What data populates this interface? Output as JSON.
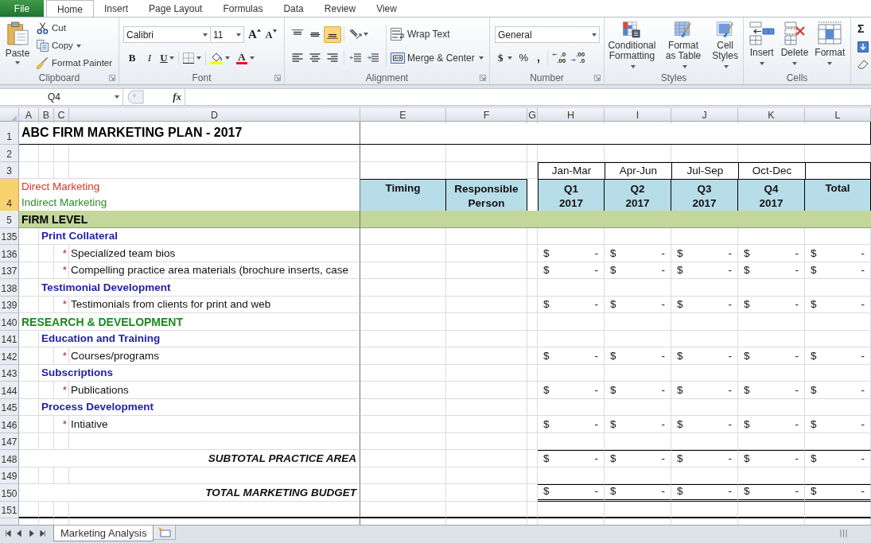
{
  "ribbon": {
    "file_tab": "File",
    "tabs": [
      {
        "label": "Home",
        "selected": true
      },
      {
        "label": "Insert",
        "selected": false
      },
      {
        "label": "Page Layout",
        "selected": false
      },
      {
        "label": "Formulas",
        "selected": false
      },
      {
        "label": "Data",
        "selected": false
      },
      {
        "label": "Review",
        "selected": false
      },
      {
        "label": "View",
        "selected": false
      }
    ]
  },
  "clipboard": {
    "paste": "Paste",
    "cut": "Cut",
    "copy": "Copy",
    "format_painter": "Format Painter",
    "label": "Clipboard"
  },
  "font": {
    "name": "Calibri",
    "size": "11",
    "grow": "A",
    "shrink": "A",
    "styles": [
      {
        "kind": "bold",
        "label": "B"
      },
      {
        "kind": "italic",
        "label": "I"
      },
      {
        "kind": "underline",
        "label": "U"
      }
    ],
    "font_color": "A",
    "label": "Font"
  },
  "alignment": {
    "vertical": [
      {
        "kind": "top",
        "selected": false
      },
      {
        "kind": "middle",
        "selected": false
      },
      {
        "kind": "bottom",
        "selected": true
      }
    ],
    "horizontal": [
      {
        "kind": "left",
        "selected": false
      },
      {
        "kind": "center",
        "selected": false
      },
      {
        "kind": "right",
        "selected": false
      }
    ],
    "wrap_text": "Wrap Text",
    "merge_center": "Merge & Center",
    "label": "Alignment"
  },
  "number": {
    "format": "General",
    "currency": "$",
    "percent": "%",
    "comma": ",",
    "increase_decimal": [
      ".0",
      ".00"
    ],
    "decrease_decimal": [
      ".00",
      ".0"
    ],
    "label": "Number"
  },
  "styles": {
    "buttons": [
      "Conditional\nFormatting",
      "Format\nas Table",
      "Cell\nStyles"
    ],
    "label": "Styles"
  },
  "cells": {
    "buttons": [
      "Insert",
      "Delete",
      "Format"
    ],
    "label": "Cells"
  },
  "editing": {
    "autosum": "Σ"
  },
  "formula_bar": {
    "name_box": "Q4",
    "function_label": "fx"
  },
  "grid": {
    "columns": [
      "A",
      "B",
      "C",
      "D",
      "E",
      "F",
      "G",
      "H",
      "I",
      "J",
      "K",
      "L"
    ],
    "rows": [
      {
        "number": "1",
        "selected": false,
        "kind": "title",
        "text": "ABC FIRM MARKETING PLAN - 2017"
      },
      {
        "number": "2",
        "selected": false,
        "kind": "blank"
      },
      {
        "number": "3",
        "selected": false,
        "kind": "periods",
        "periods": [
          "Jan-Mar",
          "Apr-Jun",
          "Jul-Sep",
          "Oct-Dec"
        ]
      },
      {
        "number": "4",
        "selected": true,
        "kind": "header",
        "legend": [
          {
            "text": "Direct Marketing",
            "color": "#e0302a"
          },
          {
            "text": "Indirect Marketing",
            "color": "#2f8a2f"
          }
        ],
        "timing": "Timing",
        "person": "Responsible Person",
        "quarters": [
          "Q1\n2017",
          "Q2\n2017",
          "Q3\n2017",
          "Q4\n2017"
        ],
        "total": "Total"
      },
      {
        "number": "5",
        "selected": false,
        "kind": "band",
        "text": "FIRM LEVEL"
      },
      {
        "number": "135",
        "selected": false,
        "kind": "subsection",
        "text": "Print Collateral"
      },
      {
        "number": "136",
        "selected": false,
        "kind": "item",
        "bullet": "*",
        "text": "Specialized team bios",
        "amounts": [
          {
            "symbol": "$",
            "value": "-"
          },
          {
            "symbol": "$",
            "value": "-"
          },
          {
            "symbol": "$",
            "value": "-"
          },
          {
            "symbol": "$",
            "value": "-"
          },
          {
            "symbol": "$",
            "value": "-"
          }
        ]
      },
      {
        "number": "137",
        "selected": false,
        "kind": "item",
        "bullet": "*",
        "text": "Compelling practice area materials (brochure inserts, case",
        "amounts": [
          {
            "symbol": "$",
            "value": "-"
          },
          {
            "symbol": "$",
            "value": "-"
          },
          {
            "symbol": "$",
            "value": "-"
          },
          {
            "symbol": "$",
            "value": "-"
          },
          {
            "symbol": "$",
            "value": "-"
          }
        ]
      },
      {
        "number": "138",
        "selected": false,
        "kind": "subsection",
        "text": "Testimonial Development"
      },
      {
        "number": "139",
        "selected": false,
        "kind": "item",
        "bullet": "*",
        "text": "Testimonials from clients for print and web",
        "amounts": [
          {
            "symbol": "$",
            "value": "-"
          },
          {
            "symbol": "$",
            "value": "-"
          },
          {
            "symbol": "$",
            "value": "-"
          },
          {
            "symbol": "$",
            "value": "-"
          },
          {
            "symbol": "$",
            "value": "-"
          }
        ]
      },
      {
        "number": "140",
        "selected": false,
        "kind": "category",
        "text": "RESEARCH & DEVELOPMENT",
        "color": "#1e8a1e"
      },
      {
        "number": "141",
        "selected": false,
        "kind": "subsection",
        "text": "Education and Training"
      },
      {
        "number": "142",
        "selected": false,
        "kind": "item",
        "bullet": "*",
        "text": "Courses/programs",
        "amounts": [
          {
            "symbol": "$",
            "value": "-"
          },
          {
            "symbol": "$",
            "value": "-"
          },
          {
            "symbol": "$",
            "value": "-"
          },
          {
            "symbol": "$",
            "value": "-"
          },
          {
            "symbol": "$",
            "value": "-"
          }
        ]
      },
      {
        "number": "143",
        "selected": false,
        "kind": "subsection",
        "text": "Subscriptions"
      },
      {
        "number": "144",
        "selected": false,
        "kind": "item",
        "bullet": "*",
        "text": "Publications",
        "amounts": [
          {
            "symbol": "$",
            "value": "-"
          },
          {
            "symbol": "$",
            "value": "-"
          },
          {
            "symbol": "$",
            "value": "-"
          },
          {
            "symbol": "$",
            "value": "-"
          },
          {
            "symbol": "$",
            "value": "-"
          }
        ]
      },
      {
        "number": "145",
        "selected": false,
        "kind": "subsection",
        "text": "Process Development"
      },
      {
        "number": "146",
        "selected": false,
        "kind": "item",
        "bullet": "*",
        "text": "Intiative",
        "amounts": [
          {
            "symbol": "$",
            "value": "-"
          },
          {
            "symbol": "$",
            "value": "-"
          },
          {
            "symbol": "$",
            "value": "-"
          },
          {
            "symbol": "$",
            "value": "-"
          },
          {
            "symbol": "$",
            "value": "-"
          }
        ]
      },
      {
        "number": "147",
        "selected": false,
        "kind": "blank"
      },
      {
        "number": "148",
        "selected": false,
        "kind": "subtotal",
        "text": "SUBTOTAL PRACTICE AREA",
        "amounts": [
          {
            "symbol": "$",
            "value": "-"
          },
          {
            "symbol": "$",
            "value": "-"
          },
          {
            "symbol": "$",
            "value": "-"
          },
          {
            "symbol": "$",
            "value": "-"
          },
          {
            "symbol": "$",
            "value": "-"
          }
        ]
      },
      {
        "number": "149",
        "selected": false,
        "kind": "blank"
      },
      {
        "number": "150",
        "selected": false,
        "kind": "total",
        "text": "TOTAL MARKETING BUDGET",
        "amounts": [
          {
            "symbol": "$",
            "value": "-"
          },
          {
            "symbol": "$",
            "value": "-"
          },
          {
            "symbol": "$",
            "value": "-"
          },
          {
            "symbol": "$",
            "value": "-"
          },
          {
            "symbol": "$",
            "value": "-"
          }
        ]
      },
      {
        "number": "151",
        "selected": false,
        "kind": "blank"
      }
    ]
  },
  "sheet_tabs": [
    {
      "label": "Marketing Analysis",
      "selected": true
    }
  ]
}
